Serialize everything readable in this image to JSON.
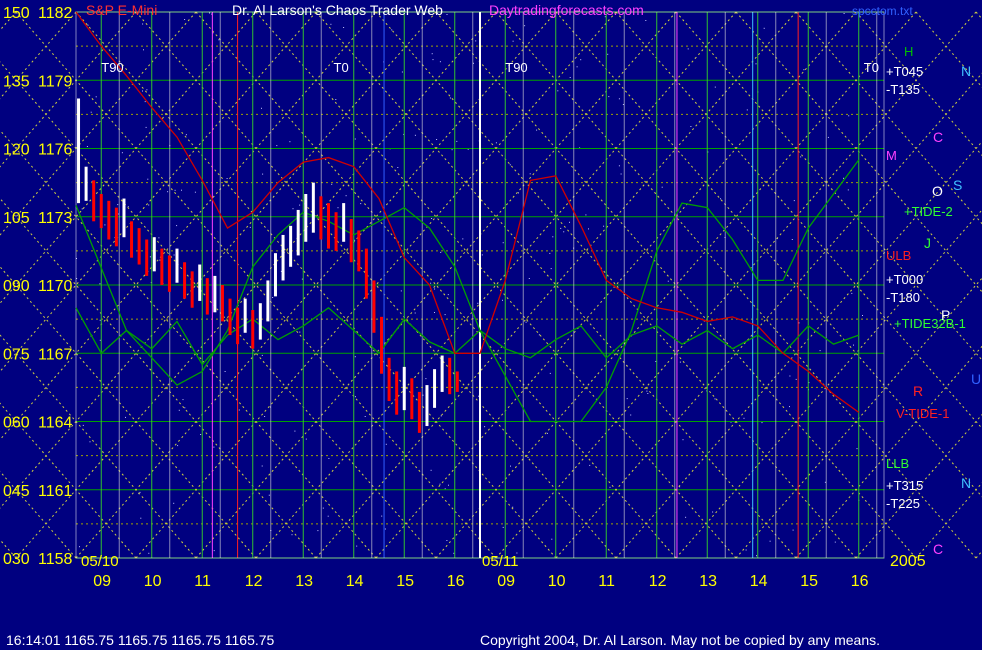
{
  "header": {
    "instrument": "S&P E-Mini",
    "title": "Dr. Al Larson's Chaos Trader Web",
    "site": "Daytradingforecasts.com",
    "filename": "spcctom.txt"
  },
  "status_line": "16:14:01  1165.75 1165.75 1165.75 1165.75",
  "copyright": "Copyright 2004, Dr. Al Larson. May not be copied by any means.",
  "year": "2005",
  "date_labels": [
    "05/10",
    "05/11"
  ],
  "colors": {
    "background": "#000080",
    "price_up": "#ffffff",
    "price_down": "#ff0000",
    "axis_text": "#ffff00",
    "grid_green": "#00c000",
    "tide": "#00a000",
    "red_line": "#d00000"
  },
  "chart_data": {
    "type": "line",
    "title": "S&P E-Mini",
    "y_axis_left_labels": [
      "150",
      "135",
      "120",
      "105",
      "090",
      "075",
      "060",
      "045",
      "030"
    ],
    "y_axis_price_labels": [
      "1182",
      "1179",
      "1176",
      "1173",
      "1170",
      "1167",
      "1164",
      "1161",
      "1158"
    ],
    "ylim": [
      1158,
      1182
    ],
    "x_hours": [
      "09",
      "10",
      "11",
      "12",
      "13",
      "14",
      "15",
      "16",
      "09",
      "10",
      "11",
      "12",
      "13",
      "14",
      "15",
      "16"
    ],
    "x_range": [
      8.5,
      24.5
    ],
    "session_break_x": 16.5,
    "hour_lines_x": [
      9,
      10,
      11,
      12,
      13,
      14,
      15,
      16,
      17,
      18,
      19,
      20,
      21,
      22,
      23,
      24
    ],
    "right_labels": [
      "H",
      "+T045",
      "-T135",
      "M",
      "+TIDE-2",
      "ULB",
      "+T000",
      "-T180",
      "+TIDE32B-1",
      "V-TIDE-1",
      "LLB",
      "+T315",
      "-T225"
    ],
    "far_right_letters": [
      "N",
      "C",
      "O",
      "S",
      "J",
      "P",
      "U",
      "R",
      "N",
      "C"
    ],
    "top_markers": [
      "T90",
      "T0",
      "T90",
      "T0"
    ],
    "series": [
      {
        "name": "price",
        "type": "candles",
        "x": [
          8.55,
          8.7,
          8.85,
          9.0,
          9.15,
          9.3,
          9.45,
          9.6,
          9.75,
          9.9,
          10.05,
          10.2,
          10.35,
          10.5,
          10.65,
          10.8,
          10.95,
          11.1,
          11.25,
          11.4,
          11.55,
          11.7,
          11.85,
          12.0,
          12.15,
          12.3,
          12.45,
          12.6,
          12.75,
          12.9,
          13.05,
          13.2,
          13.35,
          13.5,
          13.65,
          13.8,
          13.95,
          14.1,
          14.25,
          14.4,
          14.55,
          14.7,
          14.85,
          15.0,
          15.15,
          15.3,
          15.45,
          15.6,
          15.75,
          15.9,
          16.05
        ],
        "close": [
          1174.3,
          1174.4,
          1173.6,
          1173.2,
          1172.8,
          1172.5,
          1172.9,
          1172.0,
          1171.7,
          1171.2,
          1171.4,
          1170.8,
          1170.5,
          1170.9,
          1170.2,
          1169.8,
          1170.1,
          1169.5,
          1169.6,
          1169.2,
          1168.6,
          1168.2,
          1168.7,
          1168.0,
          1168.4,
          1169.2,
          1170.4,
          1171.0,
          1171.6,
          1172.1,
          1172.7,
          1173.2,
          1172.9,
          1172.5,
          1172.3,
          1172.7,
          1171.9,
          1171.5,
          1170.6,
          1169.2,
          1167.4,
          1165.8,
          1165.2,
          1165.4,
          1165.0,
          1164.3,
          1164.6,
          1165.5,
          1166.1,
          1166.0,
          1165.75
        ],
        "high": [
          1178.2,
          1175.2,
          1174.6,
          1174.0,
          1173.7,
          1173.4,
          1173.8,
          1172.8,
          1172.5,
          1172.0,
          1172.1,
          1171.6,
          1171.3,
          1171.6,
          1171.0,
          1170.6,
          1170.9,
          1170.3,
          1170.4,
          1170.0,
          1169.4,
          1169.0,
          1169.4,
          1168.9,
          1169.2,
          1170.2,
          1171.4,
          1172.2,
          1172.6,
          1173.3,
          1174.0,
          1174.5,
          1173.9,
          1173.6,
          1173.2,
          1173.6,
          1172.9,
          1172.4,
          1171.6,
          1170.2,
          1168.6,
          1166.8,
          1166.2,
          1166.4,
          1165.9,
          1165.3,
          1165.6,
          1166.3,
          1166.9,
          1166.8,
          1166.2
        ],
        "low": [
          1173.6,
          1173.7,
          1172.8,
          1172.5,
          1172.0,
          1171.7,
          1172.1,
          1171.2,
          1170.9,
          1170.4,
          1170.6,
          1170.0,
          1169.7,
          1170.1,
          1169.4,
          1169.0,
          1169.3,
          1168.7,
          1168.8,
          1168.4,
          1167.8,
          1167.4,
          1167.9,
          1167.2,
          1167.6,
          1168.4,
          1169.5,
          1170.2,
          1170.8,
          1171.3,
          1171.9,
          1172.3,
          1172.0,
          1171.6,
          1171.5,
          1171.9,
          1171.0,
          1170.6,
          1169.4,
          1167.9,
          1166.1,
          1164.9,
          1164.3,
          1164.5,
          1164.1,
          1163.5,
          1163.8,
          1164.6,
          1165.3,
          1165.2,
          1165.3
        ]
      },
      {
        "name": "TIDE-2",
        "type": "line",
        "color": "#00a000",
        "x": [
          8.5,
          9.5,
          10.5,
          11.0,
          11.5,
          12.0,
          12.5,
          13.0,
          13.5,
          14.0,
          14.5,
          15.0,
          15.5,
          16.0,
          16.5,
          17.5,
          18.5,
          19.0,
          19.5,
          20.0,
          20.5,
          21.0,
          21.5,
          22.0,
          22.5,
          23.0,
          23.5,
          24.0
        ],
        "y": [
          1173.5,
          1168.0,
          1165.6,
          1166.2,
          1168.0,
          1170.8,
          1172.2,
          1173.2,
          1172.8,
          1172.2,
          1172.8,
          1173.4,
          1172.5,
          1170.8,
          1168.0,
          1164.0,
          1164.0,
          1165.5,
          1168.0,
          1171.5,
          1173.6,
          1173.4,
          1172.0,
          1170.2,
          1170.2,
          1172.5,
          1174.0,
          1175.5
        ]
      },
      {
        "name": "TIDE32B-1",
        "type": "line",
        "color": "#00a000",
        "x": [
          8.5,
          9.0,
          9.5,
          10.0,
          10.5,
          11.0,
          11.5,
          12.0,
          12.5,
          13.0,
          13.5,
          14.0,
          14.5,
          15.0,
          15.5,
          16.0,
          16.5,
          17.0,
          17.5,
          18.0,
          18.5,
          19.0,
          19.5,
          20.0,
          20.5,
          21.0,
          21.5,
          22.0,
          22.5,
          23.0,
          23.5,
          24.0
        ],
        "y": [
          1169.0,
          1167.0,
          1168.0,
          1167.2,
          1168.4,
          1166.5,
          1167.8,
          1168.5,
          1167.6,
          1168.2,
          1169.0,
          1168.0,
          1167.0,
          1168.5,
          1167.5,
          1167.0,
          1168.0,
          1167.2,
          1166.8,
          1167.6,
          1168.2,
          1166.8,
          1167.8,
          1168.2,
          1167.4,
          1168.0,
          1167.2,
          1167.8,
          1167.0,
          1168.2,
          1167.4,
          1167.8
        ]
      },
      {
        "name": "TIDE-1",
        "type": "line",
        "color": "#d00000",
        "x": [
          8.5,
          9.0,
          9.5,
          10.0,
          10.5,
          11.0,
          11.5,
          12.0,
          12.5,
          13.0,
          13.5,
          14.0,
          14.5,
          15.0,
          15.5,
          16.0,
          16.5,
          17.0,
          17.5,
          18.0,
          18.5,
          19.0,
          19.5,
          20.0,
          20.5,
          21.0,
          21.5,
          22.0,
          22.5,
          23.0,
          23.5,
          24.0
        ],
        "y": [
          1182.0,
          1180.5,
          1179.2,
          1177.8,
          1176.5,
          1174.6,
          1172.5,
          1173.2,
          1174.5,
          1175.4,
          1175.6,
          1175.2,
          1173.8,
          1171.2,
          1170.0,
          1167.0,
          1167.0,
          1170.2,
          1174.6,
          1174.8,
          1172.6,
          1170.2,
          1169.4,
          1169.0,
          1168.8,
          1168.4,
          1168.6,
          1168.2,
          1167.0,
          1166.2,
          1165.2,
          1164.4
        ]
      }
    ]
  }
}
